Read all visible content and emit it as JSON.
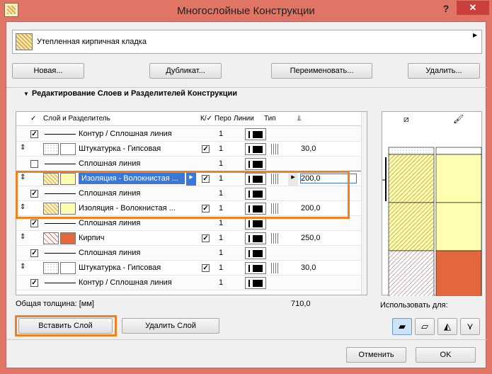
{
  "window": {
    "title": "Многослойные Конструкции",
    "help_label": "?",
    "close_label": "✕"
  },
  "preset": {
    "name": "Утепленная кирпичная кладка",
    "arrow": "▶"
  },
  "top_buttons": {
    "new": "Новая...",
    "duplicate": "Дубликат...",
    "rename": "Переименовать...",
    "delete": "Удалить..."
  },
  "section": {
    "title": "Редактирование Слоев и Разделителей Конструкции",
    "triangle": "▼"
  },
  "grid": {
    "headers": {
      "check": "✓",
      "layer": "Слой и Разделитель",
      "core": "К/✓",
      "pen": "Перо",
      "lines": "Линии",
      "type": "Тип",
      "thickness": "⫫"
    },
    "rows": [
      {
        "kind": "separator",
        "checked": true,
        "name": "Контур / Сплошная линия",
        "pen": "1"
      },
      {
        "kind": "layer",
        "checked": true,
        "name": "Штукатурка - Гипсовая",
        "pen": "1",
        "thickness": "30,0",
        "fill": "plaster"
      },
      {
        "kind": "separator",
        "checked": false,
        "name": "Сплошная линия",
        "pen": "1"
      },
      {
        "kind": "layer",
        "checked": true,
        "name": "Изоляция - Волокнистая ...",
        "pen": "1",
        "thickness": "200,0",
        "fill": "insulation",
        "selected": true
      },
      {
        "kind": "separator",
        "checked": true,
        "name": "Сплошная линия",
        "pen": "1"
      },
      {
        "kind": "layer",
        "checked": true,
        "name": "Изоляция - Волокнистая ...",
        "pen": "1",
        "thickness": "200,0",
        "fill": "insulation"
      },
      {
        "kind": "separator",
        "checked": true,
        "name": "Сплошная линия",
        "pen": "1"
      },
      {
        "kind": "layer",
        "checked": true,
        "name": "Кирпич",
        "pen": "1",
        "thickness": "250,0",
        "fill": "brick"
      },
      {
        "kind": "separator",
        "checked": true,
        "name": "Сплошная линия",
        "pen": "1"
      },
      {
        "kind": "layer",
        "checked": true,
        "name": "Штукатурка - Гипсовая",
        "pen": "1",
        "thickness": "30,0",
        "fill": "plaster"
      },
      {
        "kind": "separator",
        "checked": true,
        "name": "Контур / Сплошная линия",
        "pen": "1"
      }
    ],
    "total_label": "Общая толщина: [мм]",
    "total_value": "710,0"
  },
  "preview": {
    "use_for_label": "Использовать для:"
  },
  "layer_buttons": {
    "insert": "Вставить Слой",
    "remove": "Удалить Слой"
  },
  "footer": {
    "cancel": "Отменить",
    "ok": "OK"
  },
  "colors": {
    "insulation": "#fefdb0",
    "brick": "#e3673d",
    "plaster": "#ffffff",
    "highlight": "#f08020",
    "selection": "#3a78d8"
  }
}
